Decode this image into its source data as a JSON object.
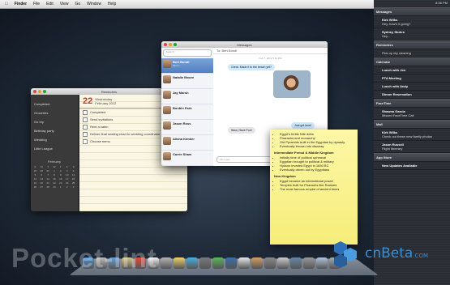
{
  "menubar": {
    "app": "Finder",
    "items": [
      "File",
      "Edit",
      "View",
      "Go",
      "Window",
      "Help"
    ]
  },
  "notification_center": {
    "sections": [
      {
        "title": "Messages",
        "items": [
          {
            "name": "Kirk Wilks",
            "text": "Hey, how's it going?"
          },
          {
            "name": "Sydney Stuhrs",
            "text": "Hey..."
          }
        ]
      },
      {
        "title": "Reminders",
        "items": [
          {
            "name": "",
            "text": "Pick up dry cleaning"
          }
        ]
      },
      {
        "title": "Calendar",
        "items": [
          {
            "name": "Lunch with Jen",
            "text": ""
          },
          {
            "name": "PTA Meeting",
            "text": ""
          },
          {
            "name": "Lunch with Andy",
            "text": ""
          },
          {
            "name": "Dinner Reservation",
            "text": ""
          }
        ]
      },
      {
        "title": "FaceTime",
        "items": [
          {
            "name": "Shawna Garcia",
            "text": "Missed FaceTime Call"
          }
        ]
      },
      {
        "title": "Mail",
        "items": [
          {
            "name": "Kirk Wilks",
            "text": "Check out these new family photos"
          },
          {
            "name": "Jason Russell",
            "text": "Flight Itinerary"
          }
        ]
      },
      {
        "title": "App Store",
        "items": [
          {
            "name": "New Updates Available",
            "text": ""
          }
        ]
      }
    ],
    "clock": "8:36 PM"
  },
  "reminders": {
    "title": "Reminders",
    "sidebar": [
      "Completed",
      "Groceries",
      "Go trip",
      "Birthday party",
      "Wedding",
      "Little League"
    ],
    "calendar": {
      "month": "February",
      "days": [
        "S",
        "M",
        "T",
        "W",
        "T",
        "F",
        "S",
        "29",
        "30",
        "31",
        "1",
        "2",
        "3",
        "4",
        "5",
        "6",
        "7",
        "8",
        "9",
        "10",
        "11",
        "12",
        "13",
        "14",
        "15",
        "16",
        "17",
        "18",
        "19",
        "20",
        "21",
        "22",
        "23",
        "24",
        "25",
        "26",
        "27",
        "28",
        "29",
        "1",
        "2",
        "3"
      ]
    },
    "date": {
      "num": "22",
      "weekday": "Wednesday",
      "full": "February 2012"
    },
    "tasks": [
      "Completed",
      "Send invitations",
      "Rent a cabin",
      "Deliver final seating chart to wedding coordinator",
      "Choose menu"
    ]
  },
  "messages": {
    "title": "Messages",
    "search_placeholder": "Search",
    "to": "To: Bert Bondl",
    "timestamp": "Feb 7, 2012 5:10 PM",
    "conversations": [
      {
        "name": "Bert Bondl",
        "preview": "Mmm..."
      },
      {
        "name": "Natalie Moore",
        "preview": ""
      },
      {
        "name": "Jay Marsh",
        "preview": ""
      },
      {
        "name": "Bonbin Park",
        "preview": ""
      },
      {
        "name": "Jason Ross",
        "preview": ""
      },
      {
        "name": "Alisha Kimber",
        "preview": ""
      },
      {
        "name": "Carrie Shaw",
        "preview": ""
      }
    ],
    "bubbles": [
      {
        "text": "Great. Made it to the beach yet?",
        "dir": "out"
      },
      {
        "text": "Wow, Have Fun!",
        "dir": "in"
      },
      {
        "text": "Just got here!",
        "dir": "out"
      },
      {
        "text": "Will take photos soon",
        "dir": "out"
      }
    ],
    "compose_placeholder": "iMessage"
  },
  "stickies": {
    "sections": [
      {
        "heading": "",
        "items": [
          "Egypt's fertile Nile delta",
          "Pharaohs and monarchy",
          "Old Pyramids built in the Egyptian by dynasty",
          "Eventually thrown into disarray"
        ]
      },
      {
        "heading": "Intermediate Period & Middle Kingdom",
        "items": [
          "Initially time of political upheaval",
          "Egyptian brought to political & military",
          "Hyksos invaded Egypt in 1650 BC",
          "Eventually driven out by Egyptians"
        ]
      },
      {
        "heading": "New Kingdom",
        "items": [
          "Egypt became an international power",
          "Temples built for Pharaohs like Ramses",
          "The most famous empire of ancient times"
        ]
      }
    ]
  },
  "watermarks": {
    "left": "Pocket-lint",
    "right": "cnBeta",
    "right_suffix": ".COM"
  }
}
